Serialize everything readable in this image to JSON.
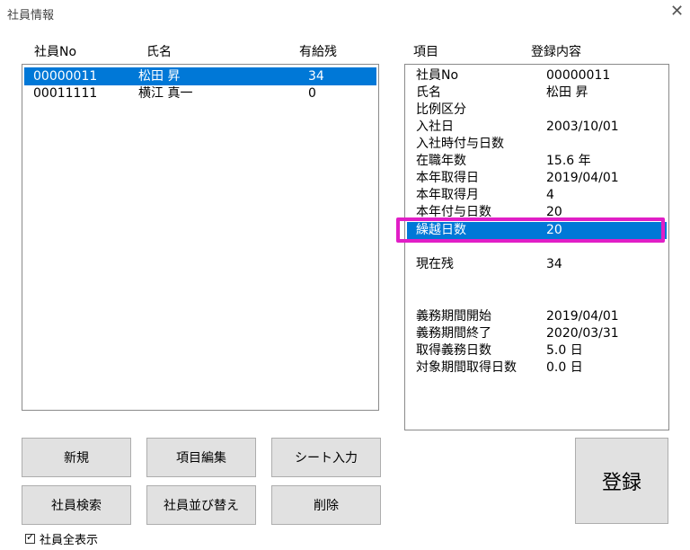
{
  "window": {
    "title": "社員情報",
    "close_glyph": "✕"
  },
  "list": {
    "headers": {
      "no": "社員No",
      "name": "氏名",
      "remaining": "有給残"
    },
    "rows": [
      {
        "no": "00000011",
        "name": "松田  昇",
        "remaining": "34",
        "selected": true
      },
      {
        "no": "00011111",
        "name": "横江  真一",
        "remaining": "0",
        "selected": false
      }
    ]
  },
  "detail": {
    "headers": {
      "item": "項目",
      "content": "登録内容"
    },
    "rows": [
      {
        "label": "社員No",
        "value": "00000011"
      },
      {
        "label": "氏名",
        "value": "松田  昇"
      },
      {
        "label": "比例区分",
        "value": ""
      },
      {
        "label": "入社日",
        "value": "2003/10/01"
      },
      {
        "label": "入社時付与日数",
        "value": ""
      },
      {
        "label": "在職年数",
        "value": "15.6 年"
      },
      {
        "label": "本年取得日",
        "value": "2019/04/01"
      },
      {
        "label": "本年取得月",
        "value": "4"
      },
      {
        "label": "本年付与日数",
        "value": "20"
      },
      {
        "label": "繰越日数",
        "value": "20",
        "selected": true
      },
      {
        "label": "",
        "value": ""
      },
      {
        "label": "現在残",
        "value": "34"
      },
      {
        "label": "",
        "value": ""
      },
      {
        "label": "",
        "value": ""
      },
      {
        "label": "義務期間開始",
        "value": "2019/04/01"
      },
      {
        "label": "義務期間終了",
        "value": "2020/03/31"
      },
      {
        "label": "取得義務日数",
        "value": "5.0 日"
      },
      {
        "label": "対象期間取得日数",
        "value": "0.0 日"
      }
    ]
  },
  "buttons": {
    "new": "新規",
    "edit_items": "項目編集",
    "sheet_input": "シート入力",
    "search": "社員検索",
    "sort": "社員並び替え",
    "delete": "削除",
    "register": "登録"
  },
  "checkbox": {
    "label": "社員全表示",
    "checked": true
  },
  "colors": {
    "selection": "#0078d7",
    "highlight": "#e11ec6"
  }
}
